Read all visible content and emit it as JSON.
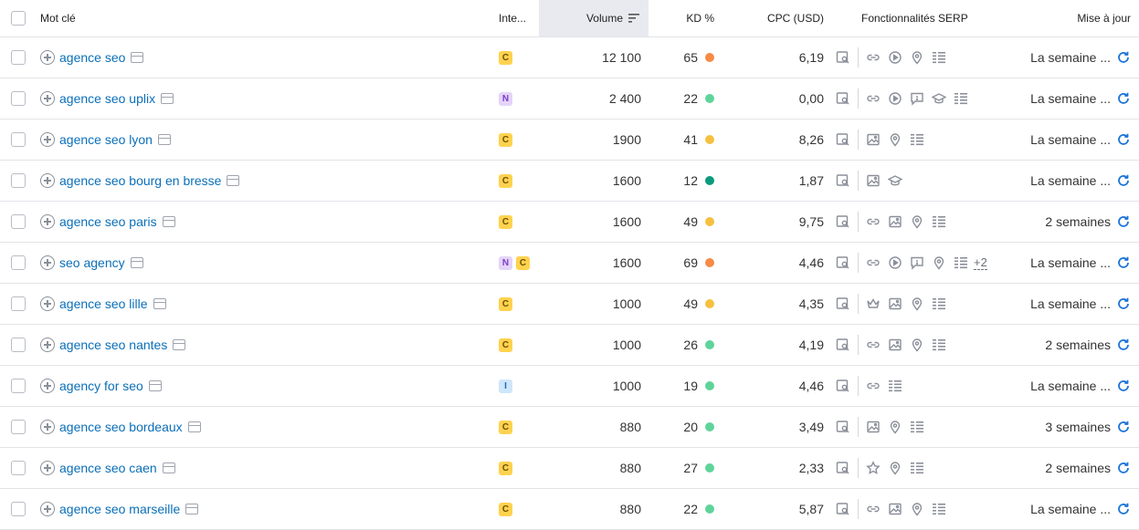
{
  "header": {
    "keyword": "Mot clé",
    "intent": "Inte...",
    "volume": "Volume",
    "kd": "KD %",
    "cpc": "CPC (USD)",
    "serp": "Fonctionnalités SERP",
    "update": "Mise à jour"
  },
  "kd_colors": {
    "orange": "#f58b45",
    "yellow": "#f6c03f",
    "lightgreen": "#5fd49a",
    "darkgreen": "#0a9b7e"
  },
  "rows": [
    {
      "keyword": "agence seo",
      "intents": [
        "C"
      ],
      "volume": "12 100",
      "kd": "65",
      "kd_color": "#f58b45",
      "cpc": "6,19",
      "serp": [
        "snippet-icon",
        "sep",
        "link-icon",
        "video-icon",
        "pin-icon",
        "list-icon"
      ],
      "more": "",
      "update": "La semaine ..."
    },
    {
      "keyword": "agence seo uplix",
      "intents": [
        "N"
      ],
      "volume": "2 400",
      "kd": "22",
      "kd_color": "#5fd49a",
      "cpc": "0,00",
      "serp": [
        "snippet-icon",
        "sep",
        "link-icon",
        "video-icon",
        "faq-icon",
        "cap-icon",
        "list-icon"
      ],
      "more": "",
      "update": "La semaine ..."
    },
    {
      "keyword": "agence seo lyon",
      "intents": [
        "C"
      ],
      "volume": "1900",
      "kd": "41",
      "kd_color": "#f6c03f",
      "cpc": "8,26",
      "serp": [
        "snippet-icon",
        "sep",
        "image-icon",
        "pin-icon",
        "list-icon"
      ],
      "more": "",
      "update": "La semaine ..."
    },
    {
      "keyword": "agence seo bourg en bresse",
      "intents": [
        "C"
      ],
      "volume": "1600",
      "kd": "12",
      "kd_color": "#0a9b7e",
      "cpc": "1,87",
      "serp": [
        "snippet-icon",
        "sep",
        "image-icon",
        "cap-icon"
      ],
      "more": "",
      "update": "La semaine ..."
    },
    {
      "keyword": "agence seo paris",
      "intents": [
        "C"
      ],
      "volume": "1600",
      "kd": "49",
      "kd_color": "#f6c03f",
      "cpc": "9,75",
      "serp": [
        "snippet-icon",
        "sep",
        "link-icon",
        "image-icon",
        "pin-icon",
        "list-icon"
      ],
      "more": "",
      "update": "2 semaines"
    },
    {
      "keyword": "seo agency",
      "intents": [
        "N",
        "C"
      ],
      "volume": "1600",
      "kd": "69",
      "kd_color": "#f58b45",
      "cpc": "4,46",
      "serp": [
        "snippet-icon",
        "sep",
        "link-icon",
        "video-icon",
        "faq-icon",
        "pin-icon",
        "list-icon"
      ],
      "more": "+2",
      "update": "La semaine ..."
    },
    {
      "keyword": "agence seo lille",
      "intents": [
        "C"
      ],
      "volume": "1000",
      "kd": "49",
      "kd_color": "#f6c03f",
      "cpc": "4,35",
      "serp": [
        "snippet-icon",
        "sep",
        "crown-icon",
        "image-icon",
        "pin-icon",
        "list-icon"
      ],
      "more": "",
      "update": "La semaine ..."
    },
    {
      "keyword": "agence seo nantes",
      "intents": [
        "C"
      ],
      "volume": "1000",
      "kd": "26",
      "kd_color": "#5fd49a",
      "cpc": "4,19",
      "serp": [
        "snippet-icon",
        "sep",
        "link-icon",
        "image-icon",
        "pin-icon",
        "list-icon"
      ],
      "more": "",
      "update": "2 semaines"
    },
    {
      "keyword": "agency for seo",
      "intents": [
        "I"
      ],
      "volume": "1000",
      "kd": "19",
      "kd_color": "#5fd49a",
      "cpc": "4,46",
      "serp": [
        "snippet-icon",
        "sep",
        "link-icon",
        "list-icon"
      ],
      "more": "",
      "update": "La semaine ..."
    },
    {
      "keyword": "agence seo bordeaux",
      "intents": [
        "C"
      ],
      "volume": "880",
      "kd": "20",
      "kd_color": "#5fd49a",
      "cpc": "3,49",
      "serp": [
        "snippet-icon",
        "sep",
        "image-icon",
        "pin-icon",
        "list-icon"
      ],
      "more": "",
      "update": "3 semaines"
    },
    {
      "keyword": "agence seo caen",
      "intents": [
        "C"
      ],
      "volume": "880",
      "kd": "27",
      "kd_color": "#5fd49a",
      "cpc": "2,33",
      "serp": [
        "snippet-icon",
        "sep",
        "star-icon",
        "pin-icon",
        "list-icon"
      ],
      "more": "",
      "update": "2 semaines"
    },
    {
      "keyword": "agence seo marseille",
      "intents": [
        "C"
      ],
      "volume": "880",
      "kd": "22",
      "kd_color": "#5fd49a",
      "cpc": "5,87",
      "serp": [
        "snippet-icon",
        "sep",
        "link-icon",
        "image-icon",
        "pin-icon",
        "list-icon"
      ],
      "more": "",
      "update": "La semaine ..."
    }
  ]
}
